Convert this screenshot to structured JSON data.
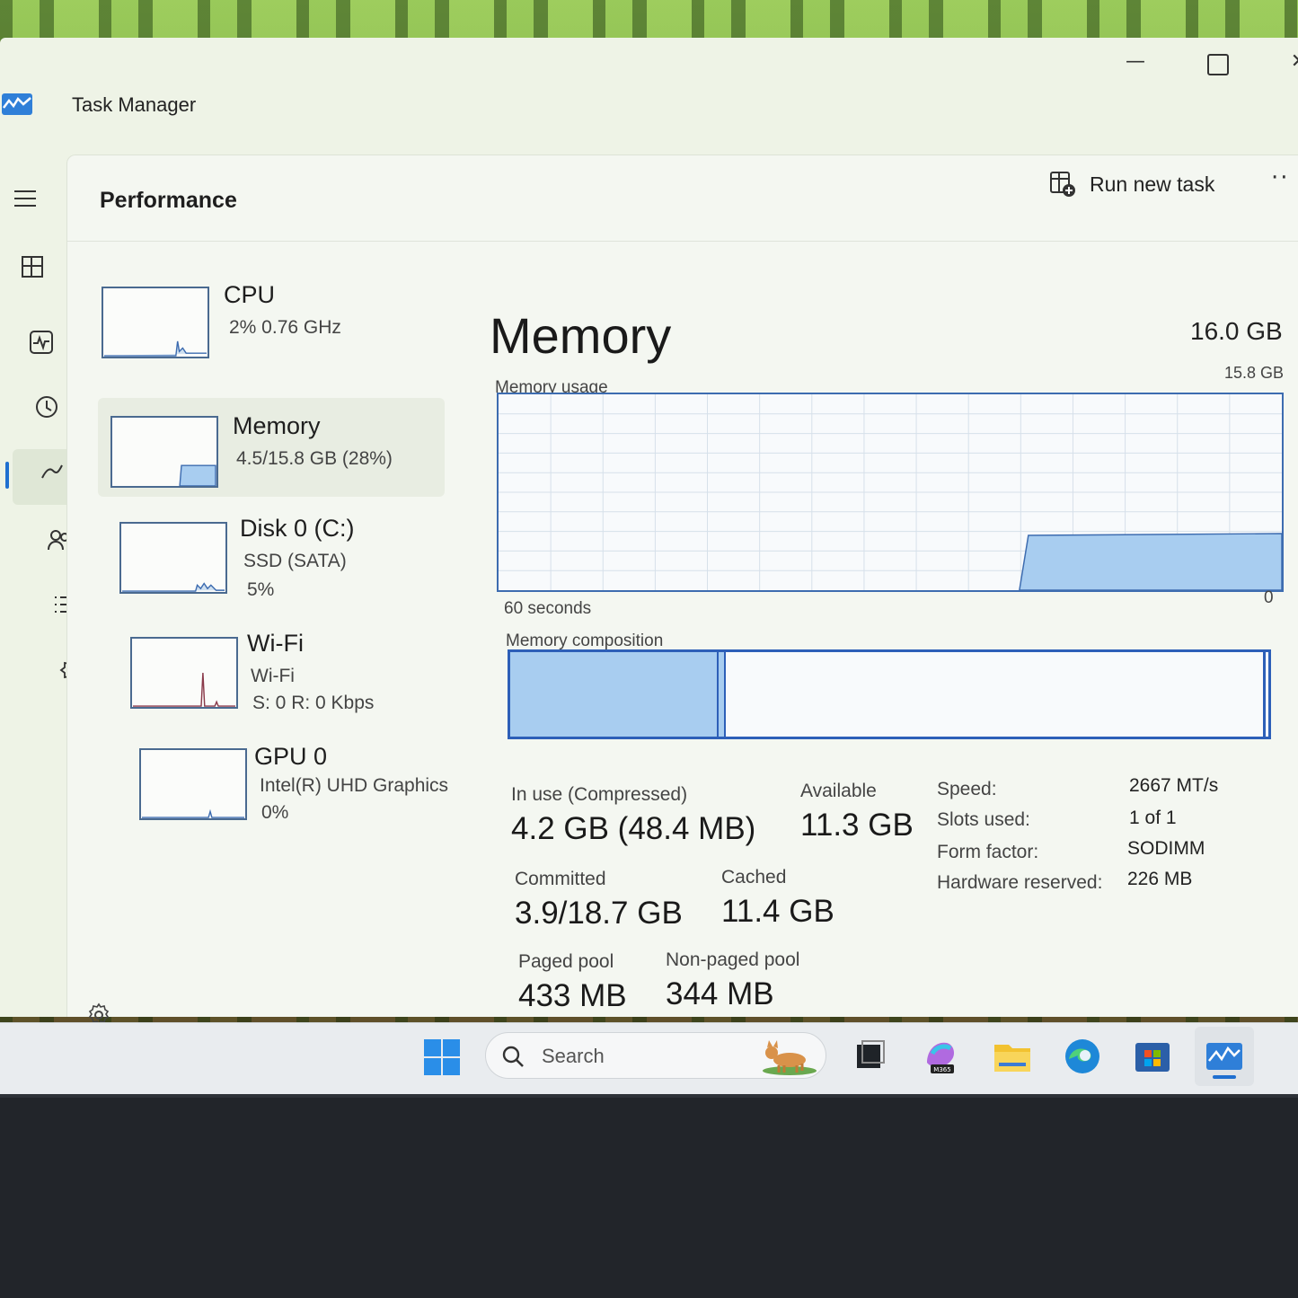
{
  "window": {
    "title": "Task Manager",
    "minimize_glyph": "—",
    "close_glyph": "✕"
  },
  "nav": {
    "items": [
      {
        "name": "hamburger-icon"
      },
      {
        "name": "processes-icon"
      },
      {
        "name": "performance-icon",
        "active": true
      },
      {
        "name": "app-history-icon"
      },
      {
        "name": "startup-apps-icon"
      },
      {
        "name": "users-icon"
      },
      {
        "name": "details-icon"
      },
      {
        "name": "services-icon"
      }
    ],
    "settings_icon": "gear-icon"
  },
  "header": {
    "title": "Performance",
    "run_new_task": "Run new task",
    "more": "··"
  },
  "devices": [
    {
      "name": "CPU",
      "line1": "2%  0.76 GHz",
      "line2": ""
    },
    {
      "name": "Memory",
      "line1": "4.5/15.8 GB (28%)",
      "line2": "",
      "selected": true
    },
    {
      "name": "Disk 0 (C:)",
      "line1": "SSD (SATA)",
      "line2": "5%"
    },
    {
      "name": "Wi-Fi",
      "line1": "Wi-Fi",
      "line2": "S: 0  R: 0 Kbps"
    },
    {
      "name": "GPU 0",
      "line1": "Intel(R) UHD Graphics",
      "line2": "0%"
    }
  ],
  "memory": {
    "title": "Memory",
    "total": "16.0 GB",
    "usage_label": "Memory usage",
    "usage_max": "15.8 GB",
    "time_label": "60 seconds",
    "usage_min": "0",
    "composition_label": "Memory composition",
    "composition_inuse_fraction": 0.272,
    "usage_fraction": 0.28,
    "stats": {
      "in_use_label": "In use (Compressed)",
      "in_use_value": "4.2 GB (48.4 MB)",
      "available_label": "Available",
      "available_value": "11.3 GB",
      "committed_label": "Committed",
      "committed_value": "3.9/18.7 GB",
      "cached_label": "Cached",
      "cached_value": "11.4 GB",
      "paged_label": "Paged pool",
      "paged_value": "433 MB",
      "nonpaged_label": "Non-paged pool",
      "nonpaged_value": "344 MB"
    },
    "specs": [
      {
        "key": "Speed:",
        "value": "2667 MT/s"
      },
      {
        "key": "Slots used:",
        "value": "1 of 1"
      },
      {
        "key": "Form factor:",
        "value": "SODIMM"
      },
      {
        "key": "Hardware reserved:",
        "value": "226 MB"
      }
    ]
  },
  "taskbar": {
    "search_placeholder": "Search",
    "apps": [
      "start-icon",
      "task-view-icon",
      "m365-copilot-icon",
      "file-explorer-icon",
      "edge-icon",
      "store-icon",
      "task-manager-icon"
    ],
    "m365_badge": "M365"
  },
  "colors": {
    "accent": "#1f6fd0",
    "graph_fill": "#a8cdf0",
    "graph_border": "#3d6cb0"
  }
}
